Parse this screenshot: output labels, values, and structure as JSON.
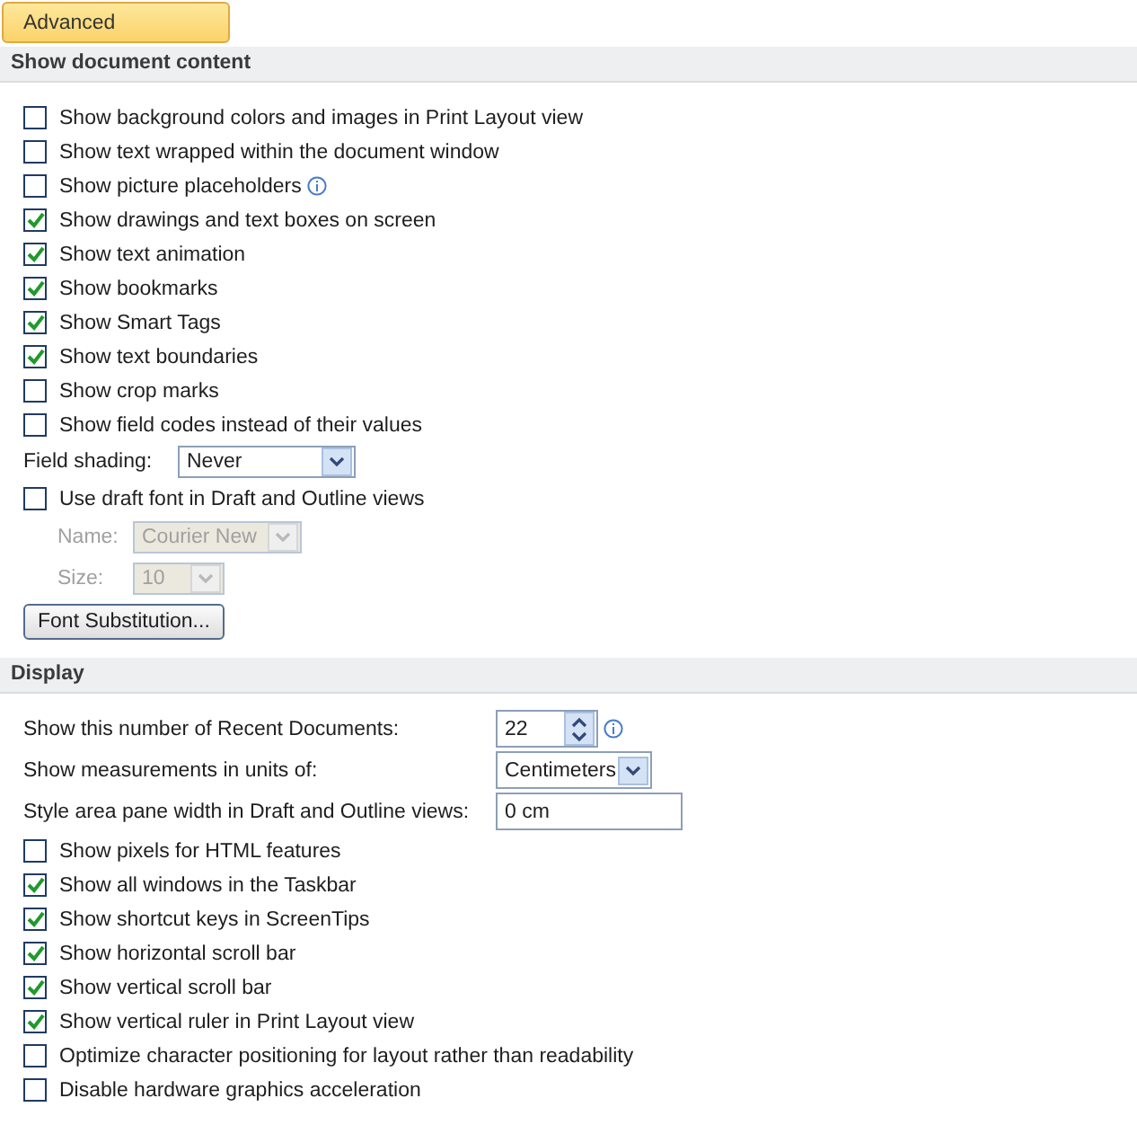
{
  "tab": {
    "label": "Advanced",
    "selected": true
  },
  "sections": [
    {
      "title": "Show document content",
      "items": [
        {
          "kind": "checkbox",
          "label": "Show background colors and images in Print Layout view",
          "checked": false
        },
        {
          "kind": "checkbox",
          "label": "Show text wrapped within the document window",
          "checked": false
        },
        {
          "kind": "checkbox",
          "label": "Show picture placeholders",
          "checked": false,
          "info": true
        },
        {
          "kind": "checkbox",
          "label": "Show drawings and text boxes on screen",
          "checked": true
        },
        {
          "kind": "checkbox",
          "label": "Show text animation",
          "checked": true
        },
        {
          "kind": "checkbox",
          "label": "Show bookmarks",
          "checked": true
        },
        {
          "kind": "checkbox",
          "label": "Show Smart Tags",
          "checked": true
        },
        {
          "kind": "checkbox",
          "label": "Show text boundaries",
          "checked": true
        },
        {
          "kind": "checkbox",
          "label": "Show crop marks",
          "checked": false
        },
        {
          "kind": "checkbox",
          "label": "Show field codes instead of their values",
          "checked": false
        },
        {
          "kind": "dropdown",
          "label": "Field shading:",
          "value": "Never",
          "disabled": false
        },
        {
          "kind": "checkbox",
          "label": "Use draft font in Draft and Outline views",
          "checked": false
        },
        {
          "kind": "subdropdown",
          "label": "Name:",
          "value": "Courier New",
          "disabled": true
        },
        {
          "kind": "subdropdown",
          "label": "Size:",
          "value": "10",
          "disabled": true
        },
        {
          "kind": "button",
          "label": "Font Substitution..."
        }
      ]
    },
    {
      "title": "Display",
      "items": [
        {
          "kind": "spinner",
          "label": "Show this number of Recent Documents:",
          "value": "22",
          "info": true
        },
        {
          "kind": "dropdown",
          "label": "Show measurements in units of:",
          "value": "Centimeters",
          "disabled": false
        },
        {
          "kind": "textbox",
          "label": "Style area pane width in Draft and Outline views:",
          "value": "0 cm"
        },
        {
          "kind": "checkbox",
          "label": "Show pixels for HTML features",
          "checked": false
        },
        {
          "kind": "checkbox",
          "label": "Show all windows in the Taskbar",
          "checked": true
        },
        {
          "kind": "checkbox",
          "label": "Show shortcut keys in ScreenTips",
          "checked": true
        },
        {
          "kind": "checkbox",
          "label": "Show horizontal scroll bar",
          "checked": true
        },
        {
          "kind": "checkbox",
          "label": "Show vertical scroll bar",
          "checked": true
        },
        {
          "kind": "checkbox",
          "label": "Show vertical ruler in Print Layout view",
          "checked": true
        },
        {
          "kind": "checkbox",
          "label": "Optimize character positioning for layout rather than readability",
          "checked": false
        },
        {
          "kind": "checkbox",
          "label": "Disable hardware graphics acceleration",
          "checked": false
        }
      ]
    }
  ]
}
